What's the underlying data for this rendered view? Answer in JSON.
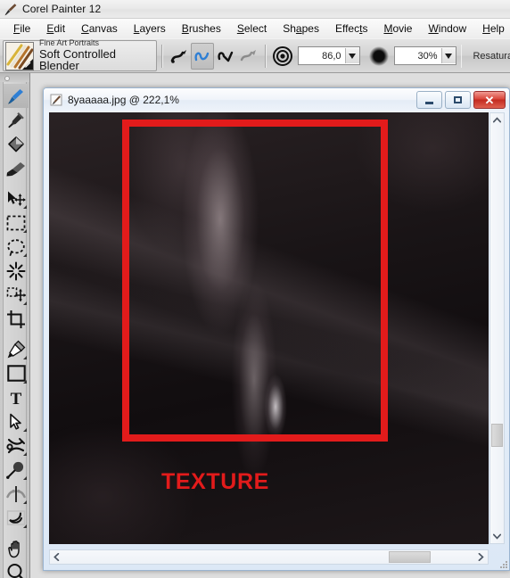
{
  "window": {
    "app_icon": "paintbrush-icon",
    "title": "Corel Painter 12"
  },
  "menu": {
    "items": [
      {
        "label": "File",
        "accel": "F"
      },
      {
        "label": "Edit",
        "accel": "E"
      },
      {
        "label": "Canvas",
        "accel": "C"
      },
      {
        "label": "Layers",
        "accel": "L"
      },
      {
        "label": "Brushes",
        "accel": "B"
      },
      {
        "label": "Select",
        "accel": "S"
      },
      {
        "label": "Shapes",
        "accel": "a"
      },
      {
        "label": "Effects",
        "accel": "t"
      },
      {
        "label": "Movie",
        "accel": "M"
      },
      {
        "label": "Window",
        "accel": "W"
      },
      {
        "label": "Help",
        "accel": "H"
      }
    ]
  },
  "property_bar": {
    "brush_thumb_icon": "brush-preset-thumbnail",
    "brush_category": "Fine Art Portraits",
    "brush_variant": "Soft Controlled Blender",
    "stroke_tools": [
      {
        "name": "freehand-stroke-icon",
        "selected": false,
        "enabled": true
      },
      {
        "name": "straight-line-stroke-icon",
        "selected": true,
        "enabled": true
      },
      {
        "name": "multi-point-stroke-icon",
        "selected": false,
        "enabled": true
      },
      {
        "name": "record-stroke-icon",
        "selected": false,
        "enabled": false
      }
    ],
    "size": {
      "icon": "brush-size-icon",
      "value": "86,0",
      "dropdown_icon": "chevron-down-icon"
    },
    "opacity": {
      "icon": "brush-opacity-icon",
      "value": "30%",
      "dropdown_icon": "chevron-down-icon"
    },
    "resaturation_label": "Resatura"
  },
  "tool_palette": {
    "tools": [
      {
        "name": "brush-tool",
        "icon": "paintbrush-icon",
        "selected": true,
        "has_flyout": false
      },
      {
        "name": "dropper-tool",
        "icon": "eyedropper-icon",
        "selected": false,
        "has_flyout": false
      },
      {
        "name": "paint-bucket-tool",
        "icon": "paint-bucket-icon",
        "selected": false,
        "has_flyout": false
      },
      {
        "name": "eraser-tool",
        "icon": "eraser-icon",
        "selected": false,
        "has_flyout": false
      },
      {
        "name": "layer-adjuster-tool",
        "icon": "arrow-move-icon",
        "selected": false,
        "has_flyout": true
      },
      {
        "name": "rectangular-selection-tool",
        "icon": "marquee-rect-icon",
        "selected": false,
        "has_flyout": true
      },
      {
        "name": "lasso-tool",
        "icon": "lasso-icon",
        "selected": false,
        "has_flyout": true
      },
      {
        "name": "magic-wand-tool",
        "icon": "magic-wand-icon",
        "selected": false,
        "has_flyout": false
      },
      {
        "name": "selection-adjuster-tool",
        "icon": "selection-move-icon",
        "selected": false,
        "has_flyout": true
      },
      {
        "name": "crop-tool",
        "icon": "crop-icon",
        "selected": false,
        "has_flyout": false
      },
      {
        "name": "pen-tool",
        "icon": "pen-nib-icon",
        "selected": false,
        "has_flyout": true
      },
      {
        "name": "rectangular-shape-tool",
        "icon": "rectangle-shape-icon",
        "selected": false,
        "has_flyout": true
      },
      {
        "name": "text-tool",
        "icon": "text-t-icon",
        "selected": false,
        "has_flyout": false
      },
      {
        "name": "shape-selection-tool",
        "icon": "arrow-pointer-icon",
        "selected": false,
        "has_flyout": true
      },
      {
        "name": "scissors-tool",
        "icon": "shape-scissors-icon",
        "selected": false,
        "has_flyout": true
      },
      {
        "name": "cloner-tool",
        "icon": "rubber-stamp-icon",
        "selected": false,
        "has_flyout": true
      },
      {
        "name": "mirror-tool",
        "icon": "mirror-icon",
        "selected": false,
        "has_flyout": true
      },
      {
        "name": "perspective-grid-tool",
        "icon": "perspective-grid-icon",
        "selected": false,
        "has_flyout": true
      },
      {
        "name": "grabber-tool",
        "icon": "hand-icon",
        "selected": false,
        "has_flyout": false
      },
      {
        "name": "magnifier-tool",
        "icon": "magnifier-icon",
        "selected": false,
        "has_flyout": false
      }
    ]
  },
  "document": {
    "icon": "document-brush-icon",
    "title": "8yaaaaa.jpg @ 222,1%",
    "filename": "8yaaaaa.jpg",
    "zoom": "222,1%",
    "window_buttons": {
      "minimize": "minimize-icon",
      "maximize": "maximize-icon",
      "close": "close-icon"
    },
    "annotations": {
      "rect_color": "#e21b1b",
      "label": "TEXTURE",
      "label_color": "#e21b1b"
    },
    "scrollbars": {
      "vertical": {
        "up_icon": "chevron-up-icon",
        "down_icon": "chevron-down-icon"
      },
      "horizontal": {
        "left_icon": "chevron-left-icon",
        "right_icon": "chevron-right-icon"
      }
    }
  }
}
